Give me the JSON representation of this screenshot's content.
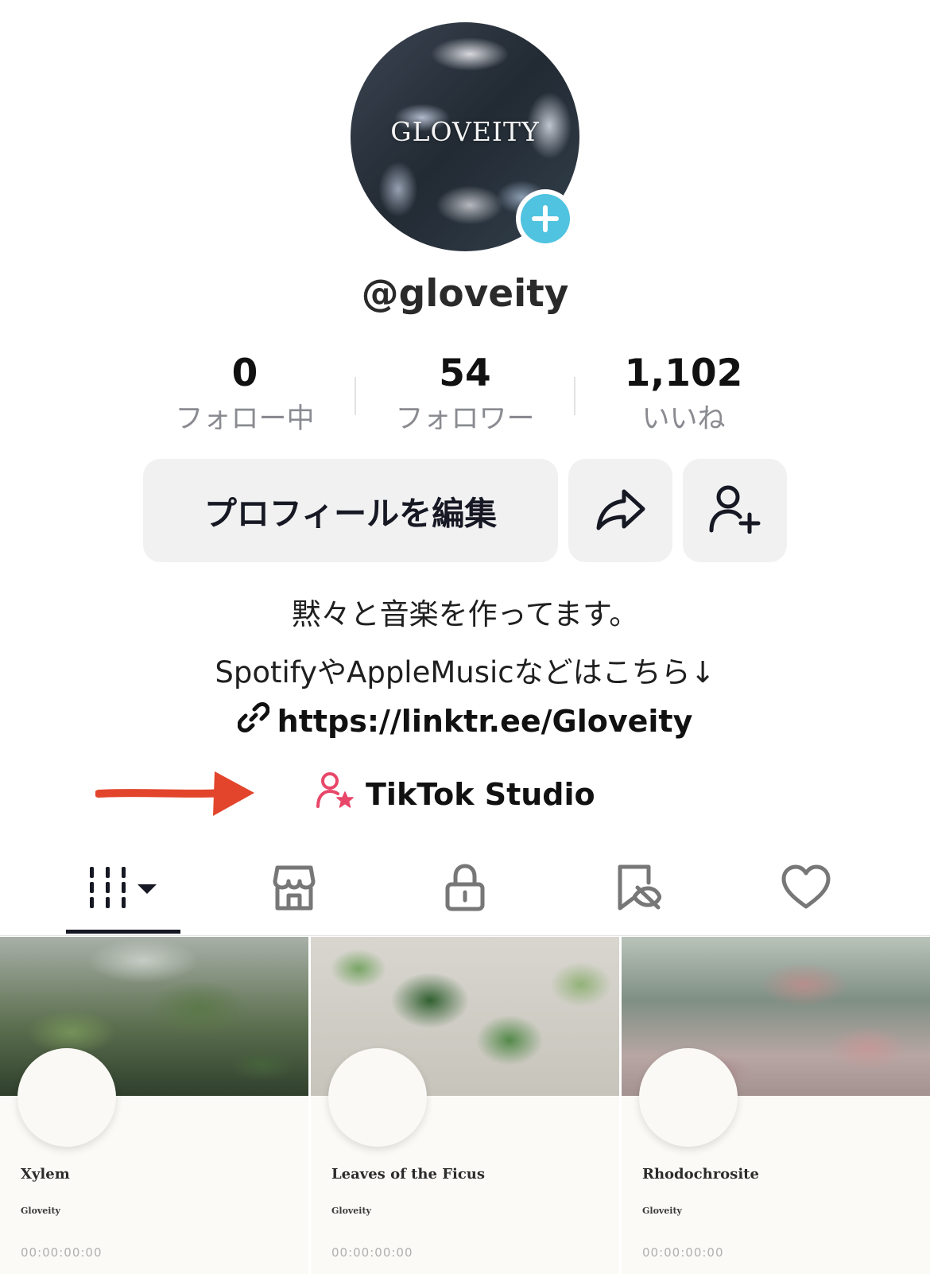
{
  "profile": {
    "avatar_logo_text": "GLOVEITY",
    "username": "@gloveity"
  },
  "stats": [
    {
      "value": "0",
      "label": "フォロー中"
    },
    {
      "value": "54",
      "label": "フォロワー"
    },
    {
      "value": "1,102",
      "label": "いいね"
    }
  ],
  "actions": {
    "edit_profile_label": "プロフィールを編集",
    "share_icon": "share-arrow-icon",
    "add_friend_icon": "add-user-icon"
  },
  "bio": {
    "line1": "黙々と音楽を作ってます。",
    "line2": "SpotifyやAppleMusicなどはこちら↓",
    "link": "https://linktr.ee/Gloveity"
  },
  "studio_label": "TikTok Studio",
  "colors": {
    "accent_blue": "#4fc3e0",
    "annotation_arrow": "#e2452c",
    "studio_icon": "#e8476a"
  },
  "tabs": [
    {
      "name": "videos",
      "icon": "grid-columns-icon",
      "active": true
    },
    {
      "name": "shop",
      "icon": "storefront-icon",
      "active": false
    },
    {
      "name": "private",
      "icon": "lock-icon",
      "active": false
    },
    {
      "name": "favorites-hidden",
      "icon": "bookmark-hidden-icon",
      "active": false
    },
    {
      "name": "liked",
      "icon": "heart-icon",
      "active": false
    }
  ],
  "videos": [
    {
      "title": "Xylem",
      "artist": "Gloveity",
      "time": "00:00:00:00"
    },
    {
      "title": "Leaves of the Ficus",
      "artist": "Gloveity",
      "time": "00:00:00:00"
    },
    {
      "title": "Rhodochrosite",
      "artist": "Gloveity",
      "time": "00:00:00:00"
    }
  ]
}
